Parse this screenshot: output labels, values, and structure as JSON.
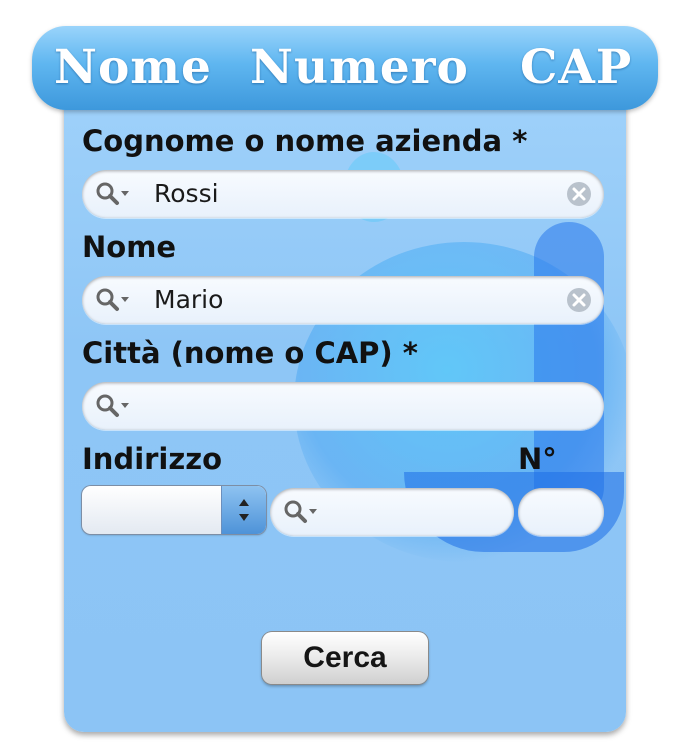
{
  "header": {
    "tabs": [
      {
        "label": "Nome"
      },
      {
        "label": "Numero"
      },
      {
        "label": "CAP"
      }
    ]
  },
  "form": {
    "cognome": {
      "label": "Cognome o nome azienda *",
      "value": "Rossi"
    },
    "nome": {
      "label": "Nome",
      "value": "Mario"
    },
    "citta": {
      "label": "Città (nome o CAP) *",
      "value": ""
    },
    "indirizzo": {
      "label": "Indirizzo",
      "select_value": "",
      "value": ""
    },
    "numero": {
      "label": "N°",
      "value": ""
    }
  },
  "actions": {
    "search_label": "Cerca"
  },
  "colors": {
    "accent": "#5fb6f0",
    "panel": "#8ec6f6"
  },
  "icons": [
    "search-icon",
    "chevron-down-icon",
    "clear-icon",
    "stepper-arrows-icon"
  ]
}
